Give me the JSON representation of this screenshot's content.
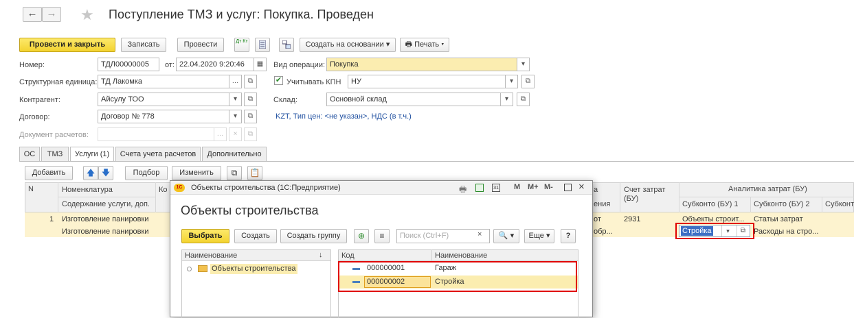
{
  "nav": {
    "back_icon": "←",
    "forward_icon": "→",
    "star_icon": "★"
  },
  "window": {
    "title": "Поступление ТМЗ и услуг: Покупка. Проведен"
  },
  "toolbar": {
    "post_close": "Провести и закрыть",
    "save": "Записать",
    "post": "Провести",
    "dtkt_icon": "Дт Кт",
    "create_based": "Создать на основании",
    "print": "Печать"
  },
  "form": {
    "number_label": "Номер:",
    "number_value": "ТДЛ00000005",
    "date_label": "от:",
    "date_value": "22.04.2020  9:20:46",
    "operation_label": "Вид операции:",
    "operation_value": "Покупка",
    "unit_label": "Структурная единица:",
    "unit_value": "ТД Лакомка",
    "kpn_label": "Учитывать КПН",
    "kpn_value": "НУ",
    "contractor_label": "Контрагент:",
    "contractor_value": "Айсулу ТОО",
    "warehouse_label": "Склад:",
    "warehouse_value": "Основной склад",
    "contract_label": "Договор:",
    "contract_value": "Договор № 778",
    "prices_link": "KZT, Тип цен: <не указан>, НДС (в т.ч.)",
    "settlement_label": "Документ расчетов:"
  },
  "tabs": [
    "ОС",
    "ТМЗ",
    "Услуги (1)",
    "Счета учета расчетов",
    "Дополнительно"
  ],
  "table_toolbar": {
    "add": "Добавить",
    "pick": "Подбор",
    "edit": "Изменить"
  },
  "table": {
    "col_n": "N",
    "col_nomen": "Номенклатура",
    "col_nomen_sub": "Содержание услуги, доп.",
    "col_cut": "Ко",
    "col_cut2": "а",
    "col_cut2_sub": "ения",
    "col_acc": "Счет затрат (БУ)",
    "analytics": "Аналитика затрат (БУ)",
    "sub1": "Субконто (БУ) 1",
    "sub2": "Субконто (БУ) 2",
    "sub3": "Субконто",
    "row": {
      "n": "1",
      "nomen": "Изготовление панировки",
      "content": "Изготовление панировки",
      "cut_a": "от",
      "cut_b": "обр...",
      "acc": "2931",
      "sub1_top": "Объекты строит...",
      "sub1_value": "Стройка",
      "sub2_top": "Статьи затрат",
      "sub2_value": "Расходы на стро..."
    }
  },
  "dialog": {
    "logo": "1С",
    "window_title": "Объекты строительства  (1С:Предприятие)",
    "wm": [
      "M",
      "M+",
      "M-"
    ],
    "heading": "Объекты строительства",
    "select": "Выбрать",
    "create": "Создать",
    "create_group": "Создать группу",
    "search_placeholder": "Поиск (Ctrl+F)",
    "more": "Еще",
    "help": "?",
    "tree_header": "Наименование",
    "tree_sort": "↓",
    "tree_root": "Объекты строительства",
    "list_code_header": "Код",
    "list_name_header": "Наименование",
    "rows": [
      {
        "code": "000000001",
        "name": "Гараж"
      },
      {
        "code": "000000002",
        "name": "Стройка"
      }
    ]
  },
  "colors": {
    "accent_yellow": "#f3d330",
    "highlight": "#fbedb0",
    "red_box": "#e00000",
    "link": "#2050a0"
  }
}
